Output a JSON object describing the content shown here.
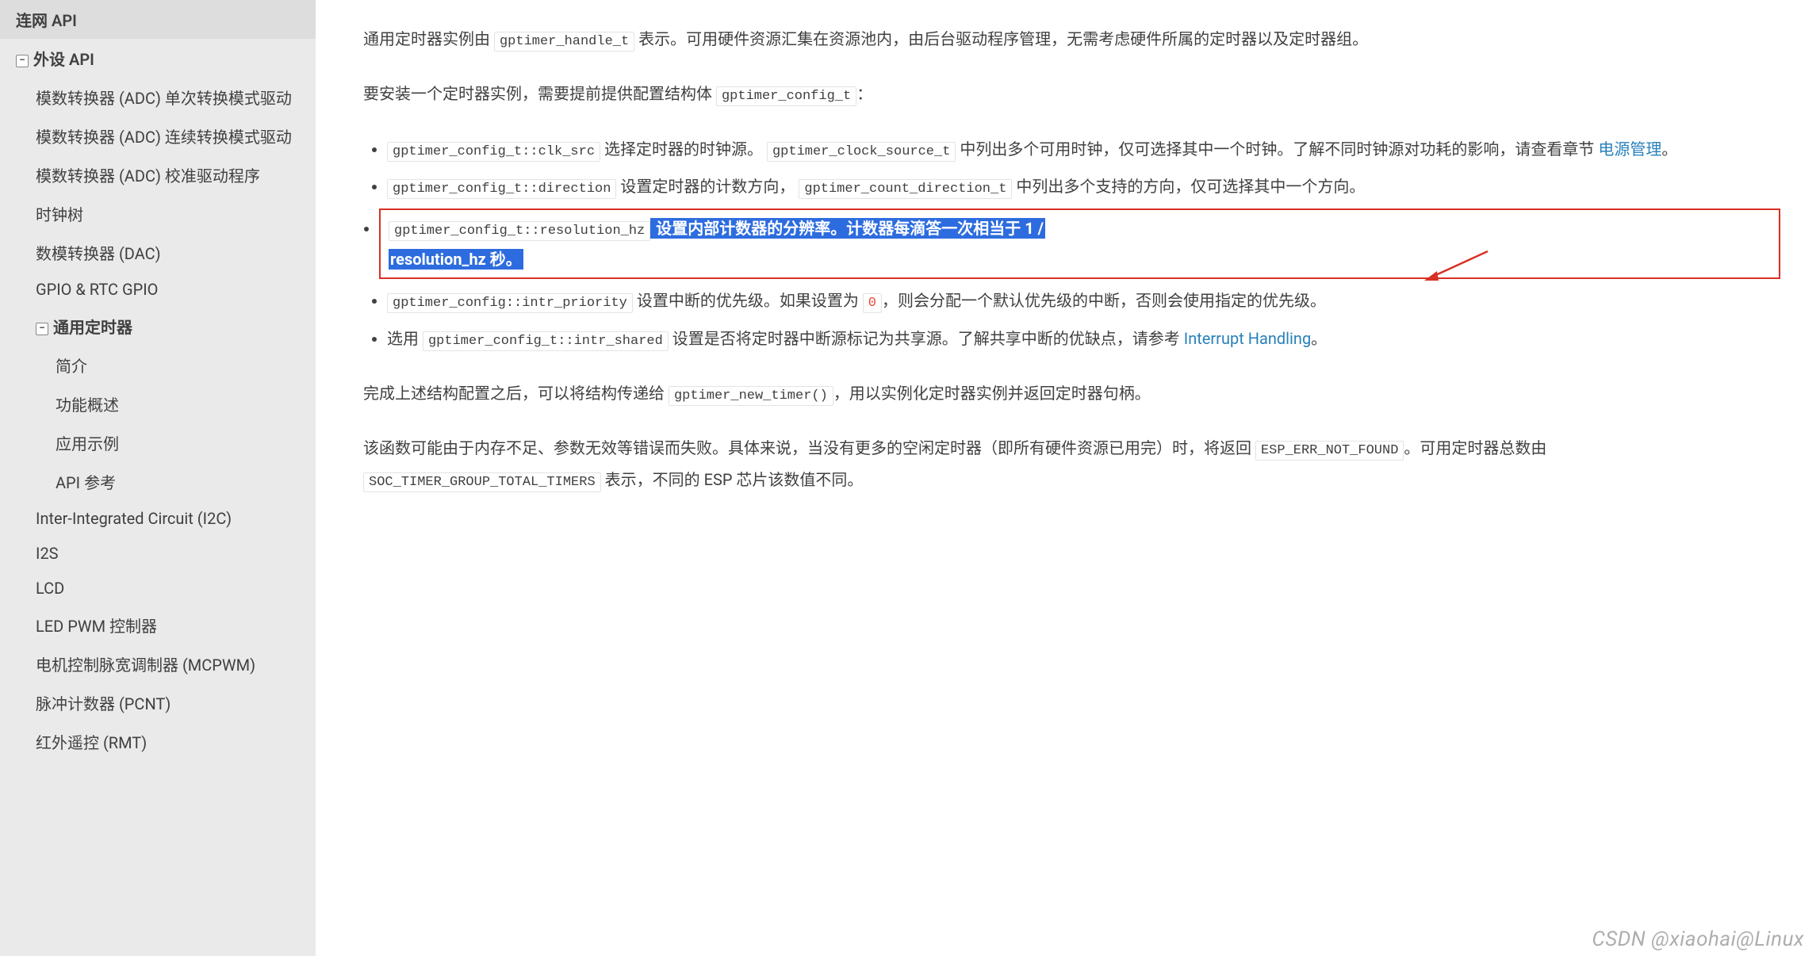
{
  "sidebar": {
    "items": [
      {
        "label": "连网 API",
        "level": "top",
        "expander": null
      },
      {
        "label": "外设 API",
        "level": "top",
        "expander": "−"
      },
      {
        "label": "模数转换器 (ADC) 单次转换模式驱动",
        "level": "lvl1"
      },
      {
        "label": "模数转换器 (ADC) 连续转换模式驱动",
        "level": "lvl1"
      },
      {
        "label": "模数转换器 (ADC) 校准驱动程序",
        "level": "lvl1"
      },
      {
        "label": "时钟树",
        "level": "lvl1"
      },
      {
        "label": "数模转换器 (DAC)",
        "level": "lvl1"
      },
      {
        "label": "GPIO & RTC GPIO",
        "level": "lvl1"
      },
      {
        "label": "通用定时器",
        "level": "lvl1",
        "expander": "−",
        "current": true
      },
      {
        "label": "简介",
        "level": "lvl2"
      },
      {
        "label": "功能概述",
        "level": "lvl2"
      },
      {
        "label": "应用示例",
        "level": "lvl2"
      },
      {
        "label": "API 参考",
        "level": "lvl2"
      },
      {
        "label": "Inter-Integrated Circuit (I2C)",
        "level": "lvl1"
      },
      {
        "label": "I2S",
        "level": "lvl1"
      },
      {
        "label": "LCD",
        "level": "lvl1"
      },
      {
        "label": "LED PWM 控制器",
        "level": "lvl1"
      },
      {
        "label": "电机控制脉宽调制器 (MCPWM)",
        "level": "lvl1"
      },
      {
        "label": "脉冲计数器 (PCNT)",
        "level": "lvl1"
      },
      {
        "label": "红外遥控 (RMT)",
        "level": "lvl1"
      }
    ]
  },
  "content": {
    "p1a": "通用定时器实例由 ",
    "p1code": "gptimer_handle_t",
    "p1b": " 表示。可用硬件资源汇集在资源池内，由后台驱动程序管理，无需考虑硬件所属的定时器以及定时器组。",
    "p2a": "要安装一个定时器实例，需要提前提供配置结构体 ",
    "p2code": "gptimer_config_t",
    "p2b": "：",
    "li1": {
      "code1": "gptimer_config_t::clk_src",
      "t1": " 选择定时器的时钟源。 ",
      "code2": "gptimer_clock_source_t",
      "t2": " 中列出多个可用时钟，仅可选择其中一个时钟。了解不同时钟源对功耗的影响，请查看章节 ",
      "link": "电源管理",
      "t3": "。"
    },
    "li2": {
      "code1": "gptimer_config_t::direction",
      "t1": " 设置定时器的计数方向， ",
      "code2": "gptimer_count_direction_t",
      "t2": " 中列出多个支持的方向，仅可选择其中一个方向。"
    },
    "li3": {
      "code1": "gptimer_config_t::resolution_hz",
      "hl1": " 设置内部计数器的分辨率。计数器每滴答一次相当于 1 / ",
      "hl2": "resolution_hz 秒。"
    },
    "li4": {
      "code1": "gptimer_config::intr_priority",
      "t1": " 设置中断的优先级。如果设置为 ",
      "code2": "0",
      "t2": "，则会分配一个默认优先级的中断，否则会使用指定的优先级。"
    },
    "li5": {
      "t0": "选用 ",
      "code1": "gptimer_config_t::intr_shared",
      "t1": " 设置是否将定时器中断源标记为共享源。了解共享中断的优缺点，请参考 ",
      "link": "Interrupt Handling",
      "t2": "。"
    },
    "p3a": "完成上述结构配置之后，可以将结构传递给 ",
    "p3code": "gptimer_new_timer()",
    "p3b": "，用以实例化定时器实例并返回定时器句柄。",
    "p4a": "该函数可能由于内存不足、参数无效等错误而失败。具体来说，当没有更多的空闲定时器（即所有硬件资源已用完）时，将返回 ",
    "p4code1": "ESP_ERR_NOT_FOUND",
    "p4b": "。可用定时器总数由 ",
    "p4code2": "SOC_TIMER_GROUP_TOTAL_TIMERS",
    "p4c": " 表示，不同的 ESP 芯片该数值不同。"
  },
  "watermark": "CSDN @xiaohai@Linux"
}
